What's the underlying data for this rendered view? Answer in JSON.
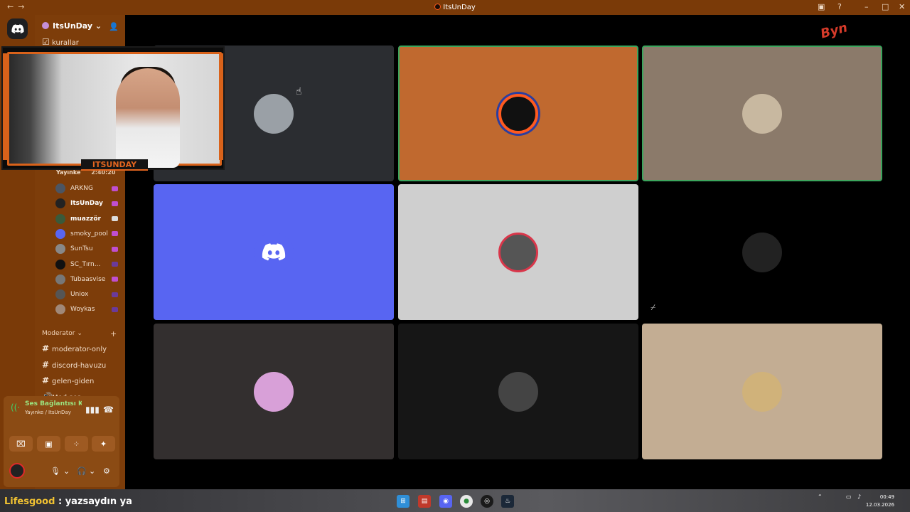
{
  "window": {
    "title": "ItsUnDay",
    "controls": {
      "back": "←",
      "forward": "→",
      "minimize": "–",
      "maximize": "□",
      "close": "✕"
    }
  },
  "server": {
    "name": "ItsUnDay",
    "top_channel": "kurallar",
    "voice_section_label": "Yayınke",
    "voice_timer": "2:40:20",
    "voice_users": [
      {
        "name": "ARKNG",
        "bold": false,
        "color": "#4b5563"
      },
      {
        "name": "ItsUnDay",
        "bold": true,
        "color": "#222222"
      },
      {
        "name": "muazzör",
        "bold": true,
        "color": "#3a5a3a"
      },
      {
        "name": "smoky_pool",
        "bold": false,
        "color": "#5865f2"
      },
      {
        "name": "SunTsu",
        "bold": false,
        "color": "#888888"
      },
      {
        "name": "SC_Tırn...",
        "bold": false,
        "color": "#111111"
      },
      {
        "name": "Tubaasvise",
        "bold": false,
        "color": "#777777"
      },
      {
        "name": "Uniox",
        "bold": false,
        "color": "#555555"
      },
      {
        "name": "Woykas",
        "bold": false,
        "color": "#a08878"
      }
    ],
    "category": "Moderator",
    "channels": [
      {
        "name": "moderator-only",
        "icon": "#"
      },
      {
        "name": "discord-havuzu",
        "icon": "#"
      },
      {
        "name": "gelen-giden",
        "icon": "#"
      },
      {
        "name": "Mod ses",
        "icon": "🔊"
      }
    ]
  },
  "voice_panel": {
    "status": "Ses Bağlantısı Kuruldu",
    "location": "Yayınke / ItsUnDay"
  },
  "webcam": {
    "nameplate": "ITSUNDAY"
  },
  "corner_logo": "Byn",
  "tiles": [
    {
      "id": "tile-1",
      "bg": "#2b2d31",
      "speaking": false,
      "avatar_bg": "#9aa0a6"
    },
    {
      "id": "tile-2",
      "bg": "#c0692f",
      "speaking": true,
      "avatar_bg": "#111111"
    },
    {
      "id": "tile-3",
      "bg": "#8b7a6a",
      "speaking": true,
      "avatar_bg": "#c8b8a0"
    },
    {
      "id": "tile-4",
      "bg": "#5865f2",
      "speaking": false,
      "avatar_bg": "#5865f2"
    },
    {
      "id": "tile-5",
      "bg": "#cfcfcf",
      "speaking": false,
      "avatar_bg": "#555555"
    },
    {
      "id": "tile-6",
      "bg": "#000000",
      "speaking": false,
      "avatar_bg": "#222222"
    },
    {
      "id": "tile-7",
      "bg": "#332f2f",
      "speaking": false,
      "avatar_bg": "#d8a0d8"
    },
    {
      "id": "tile-8",
      "bg": "#161616",
      "speaking": false,
      "avatar_bg": "#444444"
    },
    {
      "id": "tile-9",
      "bg": "#c3ad93",
      "speaking": false,
      "avatar_bg": "#d0b27a"
    }
  ],
  "chat_overlay": {
    "user": "Lifesgood",
    "separator": " : ",
    "message": "yazsaydın ya"
  },
  "taskbar": {
    "time": "00:49",
    "date": "12.03.2026"
  }
}
